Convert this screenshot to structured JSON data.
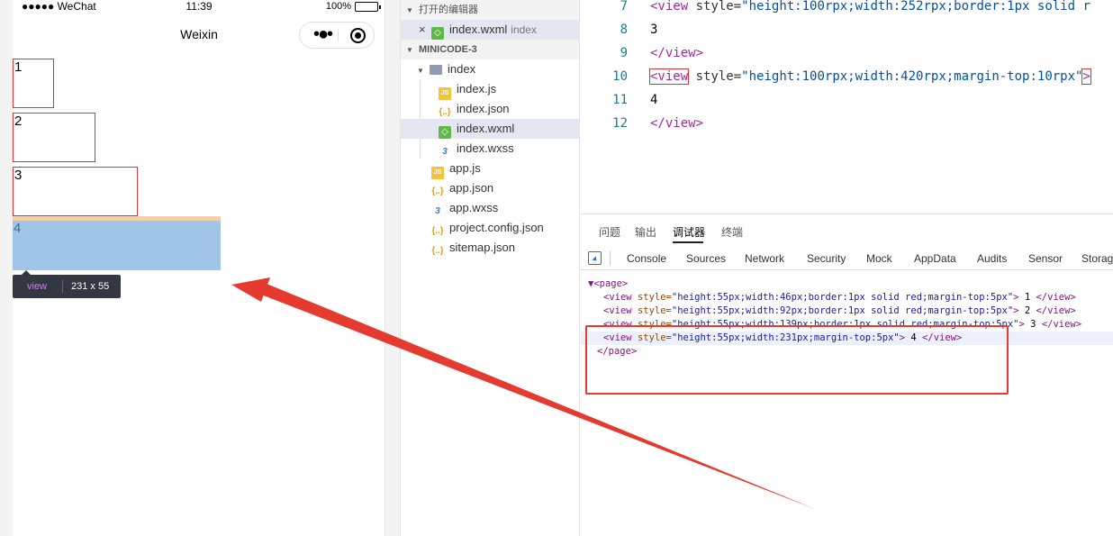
{
  "status_bar": {
    "carrier": "●●●●● WeChat",
    "time": "11:39",
    "battery": "100%"
  },
  "nav_bar": {
    "title": "Weixin",
    "more_glyph": "•●•"
  },
  "page_views": [
    "1",
    "2",
    "3",
    "4"
  ],
  "inspect_tooltip": {
    "tag": "view",
    "dims": "231 x 55"
  },
  "file_tree": {
    "open_editors_header": "打开的编辑器",
    "open_editor": {
      "name": "index.wxml",
      "folder": "index"
    },
    "project_header": "MINICODE-3",
    "folder": "index",
    "folder_files": [
      {
        "name": "index.js",
        "icon": "js-file-icon",
        "glyph": "JS"
      },
      {
        "name": "index.json",
        "icon": "json-file-icon",
        "glyph": "{..}"
      },
      {
        "name": "index.wxml",
        "icon": "wxml-file-icon",
        "glyph": "◇"
      },
      {
        "name": "index.wxss",
        "icon": "css-file-icon",
        "glyph": "3"
      }
    ],
    "root_files": [
      {
        "name": "app.js",
        "icon": "js-file-icon",
        "glyph": "JS"
      },
      {
        "name": "app.json",
        "icon": "json-file-icon",
        "glyph": "{..}"
      },
      {
        "name": "app.wxss",
        "icon": "css-file-icon",
        "glyph": "3"
      },
      {
        "name": "project.config.json",
        "icon": "json-file-icon",
        "glyph": "{..}"
      },
      {
        "name": "sitemap.json",
        "icon": "json-file-icon",
        "glyph": "{..}"
      }
    ]
  },
  "editor": {
    "lines": [
      {
        "num": "7",
        "tag_open": "<view",
        "attr": " style=",
        "value": "\"height:100rpx;width:252rpx;border:1px solid  r",
        "tag_close": ""
      },
      {
        "num": "8",
        "text": "3"
      },
      {
        "num": "9",
        "tag_open": "</view>"
      },
      {
        "num": "10",
        "tag_open": "<view",
        "attr": " style=",
        "value": "\"height:100rpx;width:420rpx;margin-top:10rpx\"",
        "tag_close": ">"
      },
      {
        "num": "11",
        "text": "4"
      },
      {
        "num": "12",
        "tag_open": "</view>"
      }
    ]
  },
  "debugger": {
    "top_tabs": [
      "问题",
      "输出",
      "调试器",
      "终端"
    ],
    "active_top_tab": "调试器",
    "panel_tabs": [
      "Console",
      "Sources",
      "Network",
      "Security",
      "Mock",
      "AppData",
      "Audits",
      "Sensor",
      "Storag"
    ],
    "dom": {
      "root_open": "▼<page>",
      "rows": [
        {
          "open": "<view",
          "attr": "style=",
          "value": "\"height:55px;width:46px;border:1px solid red;margin-top:5px\"",
          "text": "1",
          "close": "</view>"
        },
        {
          "open": "<view",
          "attr": "style=",
          "value": "\"height:55px;width:92px;border:1px solid red;margin-top:5px\"",
          "text": "2",
          "close": "</view>"
        },
        {
          "open": "<view",
          "attr": "style=",
          "value": "\"height:55px;width:139px;border:1px solid red;margin-top:5px\"",
          "text": "3",
          "close": "</view>"
        },
        {
          "open": "<view",
          "attr": "style=",
          "value": "\"height:55px;width:231px;margin-top:5px\"",
          "text": "4",
          "close": "</view>"
        }
      ],
      "root_close": "</page>"
    }
  },
  "colors": {
    "annotation_red": "#e53a2f",
    "highlight_content": "#a0c5e8",
    "highlight_margin": "#f6cfae"
  }
}
